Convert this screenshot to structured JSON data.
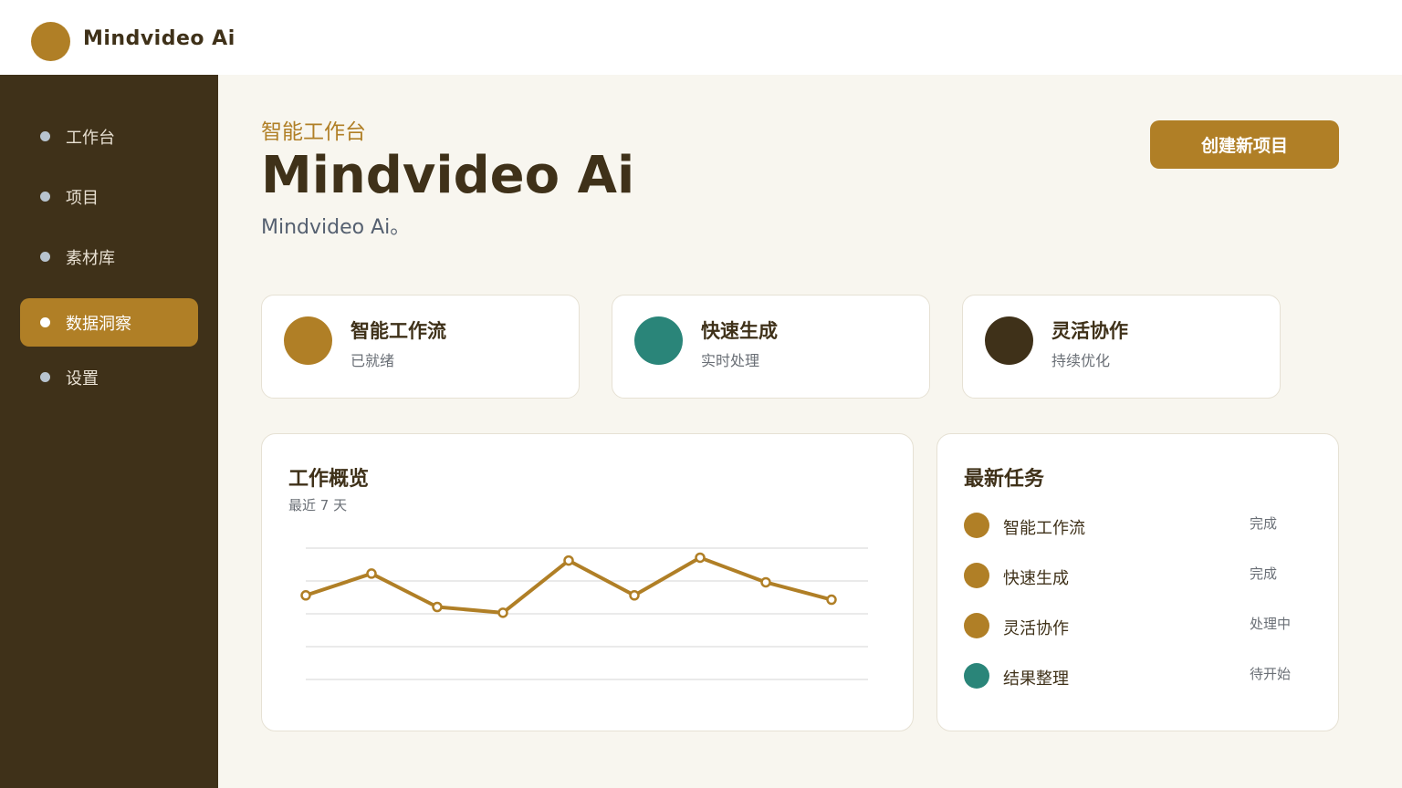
{
  "app": {
    "brand": "Mindvideo Ai",
    "accent": "#b07f26",
    "teal": "#2a8579",
    "dark": "#3f3119"
  },
  "sidebar": {
    "items": [
      {
        "label": "工作台",
        "active": false
      },
      {
        "label": "项目",
        "active": false
      },
      {
        "label": "素材库",
        "active": false
      },
      {
        "label": "数据洞察",
        "active": true
      },
      {
        "label": "设置",
        "active": false
      }
    ]
  },
  "header": {
    "eyebrow": "智能工作台",
    "title": "Mindvideo Ai",
    "subtitle": "Mindvideo Ai。",
    "create_button": "创建新项目"
  },
  "features": [
    {
      "title": "智能工作流",
      "status": "已就绪",
      "color": "#b07f26"
    },
    {
      "title": "快速生成",
      "status": "实时处理",
      "color": "#2a8579"
    },
    {
      "title": "灵活协作",
      "status": "持续优化",
      "color": "#3f3119"
    }
  ],
  "overview": {
    "title": "工作概览",
    "subtitle": "最近 7 天"
  },
  "chart_data": {
    "type": "line",
    "title": "工作概览",
    "x": [
      1,
      2,
      3,
      4,
      5,
      6,
      7,
      8,
      9
    ],
    "series": [
      {
        "values": [
          58,
          73,
          50,
          46,
          82,
          58,
          84,
          67,
          55
        ],
        "color": "#b07f26"
      }
    ],
    "ylim": [
      0,
      100
    ],
    "grid": true,
    "gridlines": 5
  },
  "tasks": {
    "title": "最新任务",
    "items": [
      {
        "name": "智能工作流",
        "state": "完成",
        "color": "#b07f26"
      },
      {
        "name": "快速生成",
        "state": "完成",
        "color": "#b07f26"
      },
      {
        "name": "灵活协作",
        "state": "处理中",
        "color": "#b07f26"
      },
      {
        "name": "结果整理",
        "state": "待开始",
        "color": "#2a8579"
      }
    ]
  }
}
